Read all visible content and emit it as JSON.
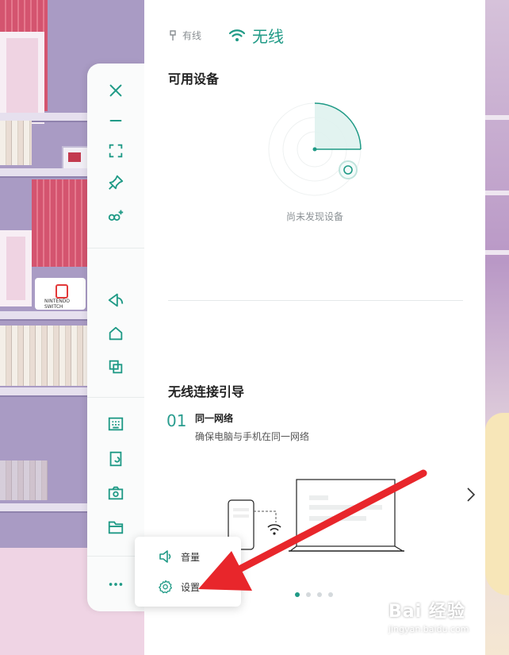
{
  "connection_tabs": {
    "wired_label": "有线",
    "wireless_label": "无线",
    "active": "wireless"
  },
  "available_devices": {
    "title": "可用设备",
    "empty_text": "尚未发现设备"
  },
  "guide": {
    "title": "无线连接引导",
    "step_number": "01",
    "step_title": "同一网络",
    "step_desc": "确保电脑与手机在同一网络",
    "pagination": {
      "total": 4,
      "current": 1
    }
  },
  "toolbar": {
    "icons": [
      "close-icon",
      "minimize-icon",
      "fullscreen-icon",
      "pin-icon",
      "screen-mirror-add-icon",
      "back-icon",
      "home-icon",
      "multitask-icon",
      "keyboard-icon",
      "screen-record-icon",
      "screenshot-icon",
      "folder-icon",
      "more-icon"
    ],
    "more_label": "···"
  },
  "popup_menu": {
    "items": [
      {
        "icon": "volume-icon",
        "label": "音量"
      },
      {
        "icon": "settings-icon",
        "label": "设置"
      }
    ]
  },
  "watermark": {
    "title": "Bai 经验",
    "url": "jingyan.baidu.com"
  },
  "colors": {
    "accent": "#1f9a86",
    "annotation_arrow": "#e8262b"
  }
}
